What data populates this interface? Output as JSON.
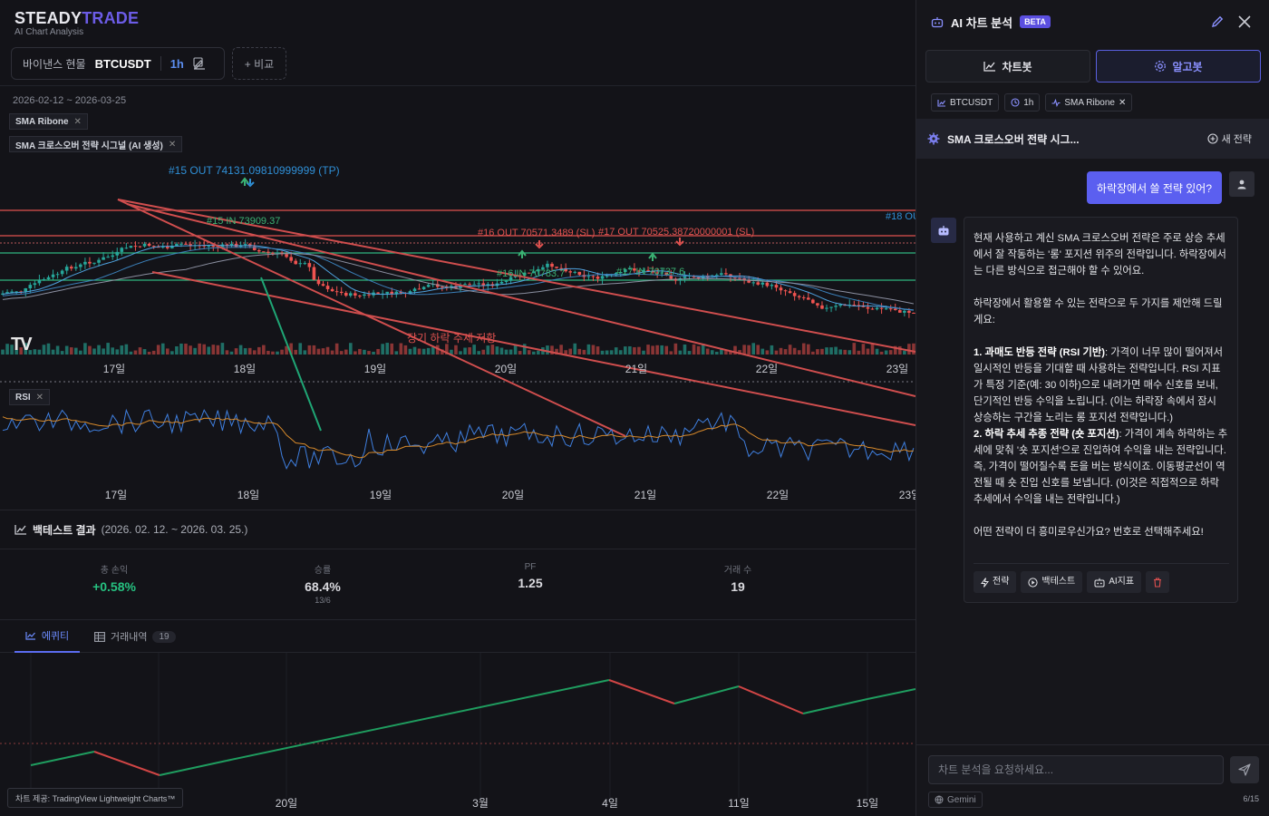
{
  "brand": {
    "name_a": "STEADY",
    "name_b": "TRADE",
    "subtitle": "AI Chart Analysis"
  },
  "toolbar": {
    "exchange": "바이낸스 현물",
    "symbol": "BTCUSDT",
    "timeframe": "1h",
    "compare_label": "+ 비교"
  },
  "chart": {
    "date_range": "2026-02-12 ~ 2026-03-25",
    "indicators": [
      "SMA Ribone",
      "SMA 크로스오버 전략 시그널 (AI 생성)"
    ],
    "rsi_label": "RSI",
    "x_labels": [
      "17일",
      "18일",
      "19일",
      "20일",
      "21일",
      "22일",
      "23일"
    ],
    "annotations": {
      "out15": "#15 OUT 74131.09810999999 (TP)",
      "in15": "#15 IN 73909.37",
      "out16": "#16 OUT 70571.3489 (SL)",
      "out17": "#17 OUT 70525.38720000001 (SL)",
      "in16": "#16 IN 70783.7",
      "in17": "#17 IN 70737.6",
      "in18": "#18 OU",
      "trend": "장기 하락 추세 저항"
    },
    "colors": {
      "up": "#26a69a",
      "down": "#ef5350",
      "in": "#3bb273",
      "out_tp": "#2f8fd6",
      "out_sl": "#e0524f"
    }
  },
  "backtest": {
    "title": "백테스트 결과",
    "range": "(2026. 02. 12. ~ 2026. 03. 25.)",
    "stats": [
      {
        "label": "총 손익",
        "value": "+0.58%",
        "sub": ""
      },
      {
        "label": "승률",
        "value": "68.4%",
        "sub": "13/6"
      },
      {
        "label": "PF",
        "value": "1.25",
        "sub": ""
      },
      {
        "label": "거래 수",
        "value": "19",
        "sub": ""
      }
    ]
  },
  "bottom_tabs": {
    "equity": "에퀴티",
    "trades": "거래내역",
    "trades_count": "19"
  },
  "equity": {
    "x_labels": [
      "20일",
      "3월",
      "4일",
      "11일",
      "15일"
    ],
    "credit": "차트 제공: TradingView Lightweight Charts™"
  },
  "panel": {
    "title": "AI 차트 분석",
    "beta": "BETA",
    "mode_chartbot": "차트봇",
    "mode_algobot": "알고봇",
    "chips": [
      "BTCUSDT",
      "1h",
      "SMA Ribone"
    ],
    "strategy_name": "SMA 크로스오버 전략 시그...",
    "new_strategy": "새 전략",
    "user_message": "하락장에서 쓸 전략 있어?",
    "bot": {
      "p1": "현재 사용하고 계신 SMA 크로스오버 전략은 주로 상승 추세에서 잘 작동하는 '롱' 포지션 위주의 전략입니다. 하락장에서는 다른 방식으로 접근해야 할 수 있어요.",
      "p2": "하락장에서 활용할 수 있는 전략으로 두 가지를 제안해 드릴게요:",
      "i1_title": "1. 과매도 반등 전략 (RSI 기반)",
      "i1_body": ": 가격이 너무 많이 떨어져서 일시적인 반등을 기대할 때 사용하는 전략입니다. RSI 지표가 특정 기준(예: 30 이하)으로 내려가면 매수 신호를 보내, 단기적인 반등 수익을 노립니다. (이는 하락장 속에서 잠시 상승하는 구간을 노리는 롱 포지션 전략입니다.)",
      "i2_title": "2. 하락 추세 추종 전략 (숏 포지션)",
      "i2_body": ": 가격이 계속 하락하는 추세에 맞춰 '숏 포지션'으로 진입하여 수익을 내는 전략입니다. 즉, 가격이 떨어질수록 돈을 버는 방식이죠. 이동평균선이 역전될 때 숏 진입 신호를 보냅니다. (이것은 직접적으로 하락 추세에서 수익을 내는 전략입니다.)",
      "p3": "어떤 전략이 더 흥미로우신가요? 번호로 선택해주세요!",
      "actions": [
        "전략",
        "백테스트",
        "AI지표"
      ]
    },
    "input_placeholder": "차트 분석을 요청하세요...",
    "model": "Gemini",
    "counter": "6/15"
  }
}
